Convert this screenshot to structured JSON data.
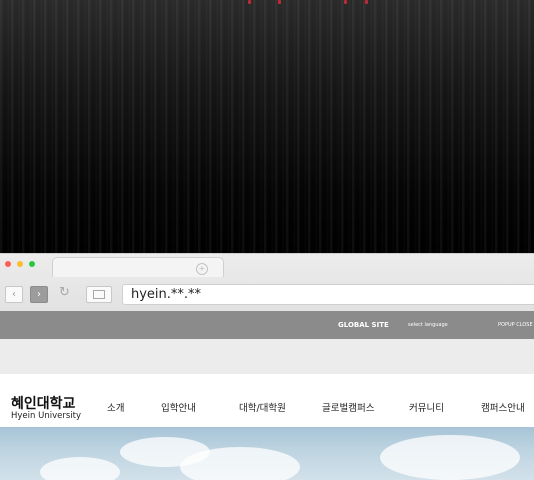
{
  "browser": {
    "url": "hyein.**.**",
    "traffic_light_colors": [
      "#ff5f57",
      "#febc2e",
      "#28c840"
    ]
  },
  "topbar": {
    "global_site": "GLOBAL SITE",
    "select_language": "select language",
    "popup_close": "POPUP CLOSE"
  },
  "site": {
    "logo_korean": "혜인대학교",
    "logo_english": "Hyein University",
    "menu": [
      "소개",
      "입학안내",
      "대학/대학원",
      "글로벌캠퍼스",
      "커뮤니티",
      "캠퍼스안내"
    ]
  },
  "colors": {
    "topbar": "#8b8b8b",
    "accent_red": "#c0283a"
  }
}
